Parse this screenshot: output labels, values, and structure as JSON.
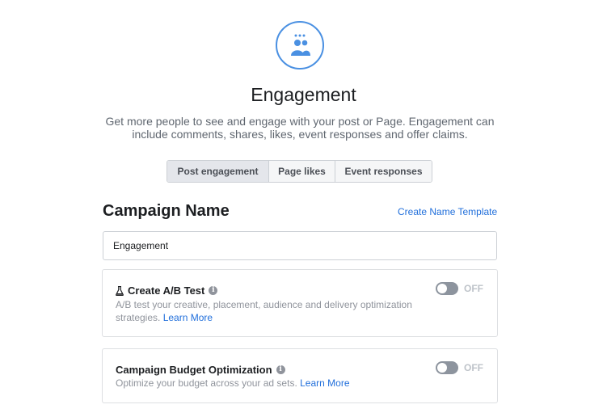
{
  "objective": {
    "icon": "people-group-icon",
    "title": "Engagement",
    "description_line1": "Get more people to see and engage with your post or Page. Engagement can",
    "description_line2": "include comments, shares, likes, event responses and offer claims."
  },
  "tabs": [
    {
      "label": "Post engagement",
      "active": true
    },
    {
      "label": "Page likes",
      "active": false
    },
    {
      "label": "Event responses",
      "active": false
    }
  ],
  "campaign_name": {
    "heading": "Campaign Name",
    "template_link": "Create Name Template",
    "input_value": "Engagement"
  },
  "ab_test": {
    "icon": "flask-icon",
    "title": "Create A/B Test",
    "description": "A/B test your creative, placement, audience and delivery optimization strategies.",
    "learn_more": "Learn More",
    "toggle_state": "OFF"
  },
  "budget_optimization": {
    "title": "Campaign Budget Optimization",
    "description": "Optimize your budget across your ad sets.",
    "learn_more": "Learn More",
    "toggle_state": "OFF"
  },
  "colors": {
    "accent": "#4a90e2",
    "link": "#216fdb",
    "toggle_off": "#8d949e"
  }
}
